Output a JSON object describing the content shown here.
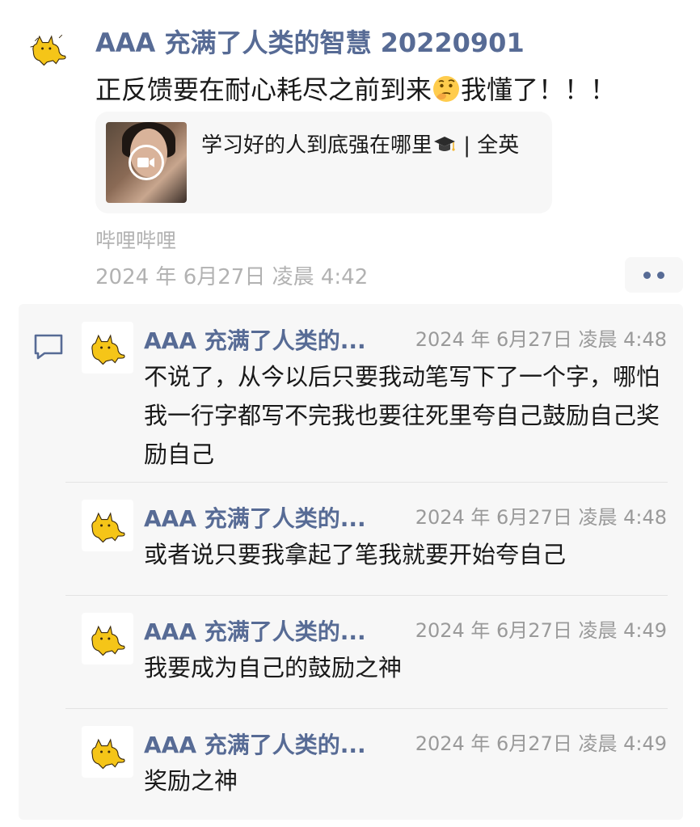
{
  "post": {
    "author": "AAA 充满了人类的智慧 20220901",
    "text": "正反馈要在耐心耗尽之前到来",
    "text_suffix": "我懂了！！！",
    "emoji_icon": "thinking-face-emoji",
    "link_card": {
      "title": "学习好的人到底强在哪里",
      "title_suffix": " | 全英",
      "title_emoji": "graduation-cap-emoji",
      "thumbnail_icon": "video-play-icon"
    },
    "source": "哔哩哔哩",
    "time": "2024 年 6月27日 凌晨 4:42"
  },
  "comments": [
    {
      "author": "AAA 充满了人类的...",
      "time": "2024 年 6月27日 凌晨 4:48",
      "text": "不说了，从今以后只要我动笔写下了一个字，哪怕我一行字都写不完我也要往死里夸自己鼓励自己奖励自己"
    },
    {
      "author": "AAA 充满了人类的...",
      "time": "2024 年 6月27日 凌晨 4:48",
      "text": "或者说只要我拿起了笔我就要开始夸自己"
    },
    {
      "author": "AAA 充满了人类的...",
      "time": "2024 年 6月27日 凌晨 4:49",
      "text": "我要成为自己的鼓励之神"
    },
    {
      "author": "AAA 充满了人类的...",
      "time": "2024 年 6月27日 凌晨 4:49",
      "text": "奖励之神"
    }
  ],
  "colors": {
    "name_link": "#576b95",
    "meta_gray": "#b2b2b2",
    "panel_bg": "#f7f7f7"
  }
}
